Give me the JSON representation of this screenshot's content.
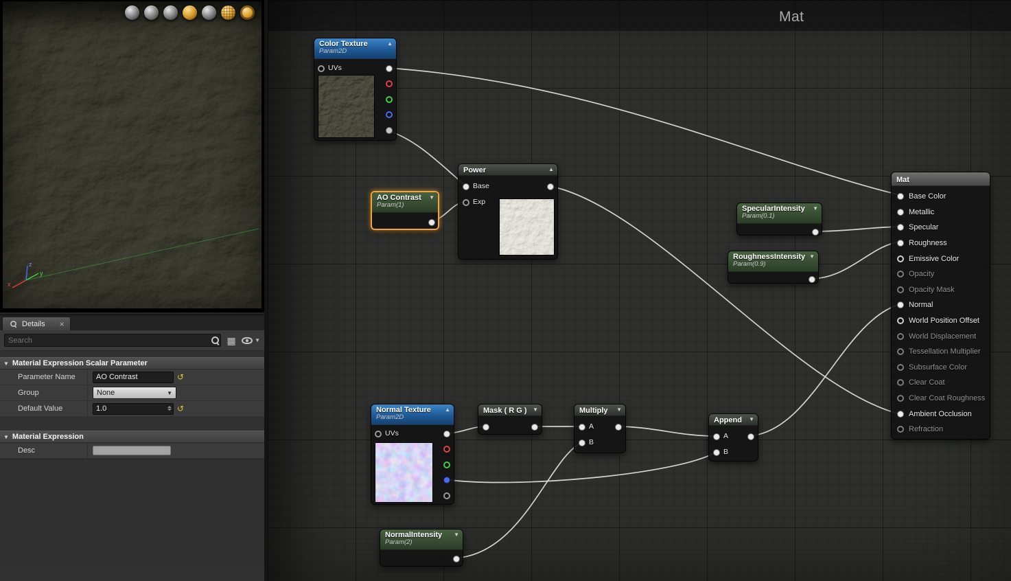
{
  "colors": {
    "selection": "#f2a43b",
    "wire": "#dcdcdc",
    "texture_header_blue": "#2f6fb0",
    "param_header_green": "#3c5a3c",
    "revert_yellow": "#e2c237"
  },
  "viewport": {
    "toolbar_icons": [
      {
        "name": "cylinder"
      },
      {
        "name": "sphere"
      },
      {
        "name": "plane"
      },
      {
        "name": "cube"
      },
      {
        "name": "teapot"
      },
      {
        "name": "grid"
      },
      {
        "name": "realtime"
      }
    ],
    "axis": {
      "x": "x",
      "y": "y",
      "z": "z"
    }
  },
  "details": {
    "tab_label": "Details",
    "close_label": "×",
    "search_placeholder": "Search",
    "sections": {
      "scalar_param": {
        "title": "Material Expression Scalar Parameter",
        "rows": {
          "parameter_name": {
            "label": "Parameter Name",
            "value": "AO Contrast"
          },
          "group": {
            "label": "Group",
            "value": "None"
          },
          "default_value": {
            "label": "Default Value",
            "value": "1.0"
          }
        }
      },
      "expression": {
        "title": "Material Expression",
        "rows": {
          "desc": {
            "label": "Desc",
            "value": ""
          }
        }
      }
    }
  },
  "graph": {
    "watermark": "Mat",
    "nodes": {
      "color_texture": {
        "title": "Color Texture",
        "subtitle": "Param2D",
        "pins": {
          "uvs": "UVs"
        }
      },
      "ao_contrast": {
        "title": "AO Contrast",
        "subtitle": "Param(1)",
        "selected": "true"
      },
      "power": {
        "title": "Power",
        "pins": {
          "base": "Base",
          "exp": "Exp"
        }
      },
      "specular_intensity": {
        "title": "SpecularIntensity",
        "subtitle": "Param(0.1)"
      },
      "roughness_intensity": {
        "title": "RoughnessIntensity",
        "subtitle": "Param(0.9)"
      },
      "normal_texture": {
        "title": "Normal Texture",
        "subtitle": "Param2D",
        "pins": {
          "uvs": "UVs"
        }
      },
      "mask_rg": {
        "title": "Mask ( R G )"
      },
      "multiply": {
        "title": "Multiply",
        "pins": {
          "a": "A",
          "b": "B"
        }
      },
      "append": {
        "title": "Append",
        "pins": {
          "a": "A",
          "b": "B"
        }
      },
      "normal_intensity": {
        "title": "NormalIntensity",
        "subtitle": "Param(2)"
      },
      "mat": {
        "title": "Mat",
        "pins": [
          {
            "label": "Base Color",
            "state": "connected"
          },
          {
            "label": "Metallic",
            "state": "connected"
          },
          {
            "label": "Specular",
            "state": "connected"
          },
          {
            "label": "Roughness",
            "state": "connected"
          },
          {
            "label": "Emissive Color",
            "state": "open"
          },
          {
            "label": "Opacity",
            "state": "disabled"
          },
          {
            "label": "Opacity Mask",
            "state": "disabled"
          },
          {
            "label": "Normal",
            "state": "connected"
          },
          {
            "label": "World Position Offset",
            "state": "open"
          },
          {
            "label": "World Displacement",
            "state": "disabled"
          },
          {
            "label": "Tessellation Multiplier",
            "state": "disabled"
          },
          {
            "label": "Subsurface Color",
            "state": "disabled"
          },
          {
            "label": "Clear Coat",
            "state": "disabled"
          },
          {
            "label": "Clear Coat Roughness",
            "state": "disabled"
          },
          {
            "label": "Ambient Occlusion",
            "state": "connected"
          },
          {
            "label": "Refraction",
            "state": "disabled"
          }
        ]
      }
    }
  }
}
